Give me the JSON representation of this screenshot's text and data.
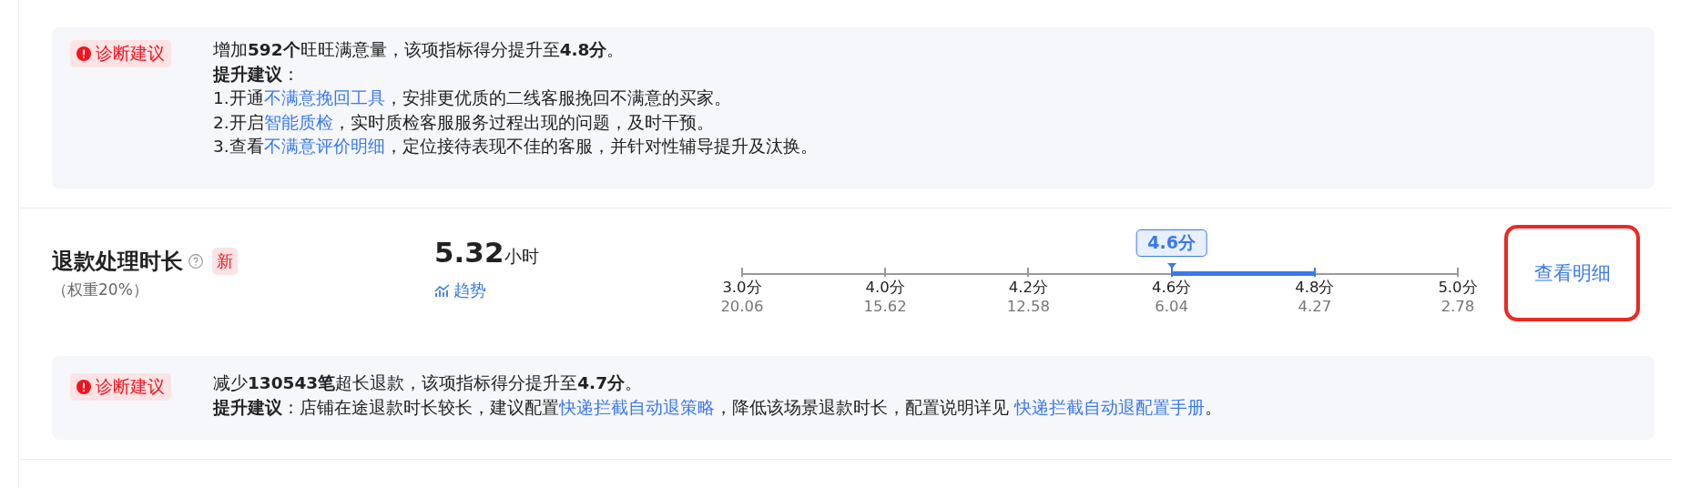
{
  "diagnosis_top": {
    "badge": "诊断建议",
    "lines": [
      [
        {
          "kind": "text",
          "text": "增加**592个**旺旺满意量，该项指标得分提升至**4.8分**。"
        }
      ],
      [
        {
          "kind": "text",
          "text": "**提升建议**："
        }
      ],
      [
        {
          "kind": "text",
          "text": "1.开通"
        },
        {
          "kind": "link",
          "text": "不满意挽回工具"
        },
        {
          "kind": "text",
          "text": "，安排更优质的二线客服挽回不满意的买家。"
        }
      ],
      [
        {
          "kind": "text",
          "text": "2.开启"
        },
        {
          "kind": "link",
          "text": "智能质检"
        },
        {
          "kind": "text",
          "text": "，实时质检客服服务过程出现的问题，及时干预。"
        }
      ],
      [
        {
          "kind": "text",
          "text": "3.查看"
        },
        {
          "kind": "link",
          "text": "不满意评价明细"
        },
        {
          "kind": "text",
          "text": "，定位接待表现不佳的客服，并针对性辅导提升及汰换。"
        }
      ]
    ]
  },
  "metric": {
    "name": "退款处理时长",
    "tag": "新",
    "weight": "（权重20%）",
    "value": "5.32",
    "unit": "小时",
    "trend": "趋势",
    "scale": {
      "callout": "4.6分",
      "ticks": [
        {
          "score": "3.0分",
          "value": "20.06",
          "current": false,
          "target": false
        },
        {
          "score": "4.0分",
          "value": "15.62",
          "current": false,
          "target": false
        },
        {
          "score": "4.2分",
          "value": "12.58",
          "current": false,
          "target": false
        },
        {
          "score": "4.6分",
          "value": "6.04",
          "current": true,
          "target": false
        },
        {
          "score": "4.8分",
          "value": "4.27",
          "current": false,
          "target": true
        },
        {
          "score": "5.0分",
          "value": "2.78",
          "current": false,
          "target": false
        }
      ]
    },
    "detail_link": {
      "label": "查看明细",
      "highlighted": true
    }
  },
  "diagnosis_bottom": {
    "badge": "诊断建议",
    "lines": [
      [
        {
          "kind": "text",
          "text": "减少**130543笔**超长退款，该项指标得分提升至**4.7分**。"
        }
      ],
      [
        {
          "kind": "text",
          "text": "**提升建议**：店铺在途退款时长较长，建议配置"
        },
        {
          "kind": "link",
          "text": "快递拦截自动退策略"
        },
        {
          "kind": "text",
          "text": "，降低该场景退款时长，配置说明详见 "
        },
        {
          "kind": "link",
          "text": "快递拦截自动退配置手册"
        },
        {
          "kind": "text",
          "text": "。"
        }
      ]
    ]
  }
}
